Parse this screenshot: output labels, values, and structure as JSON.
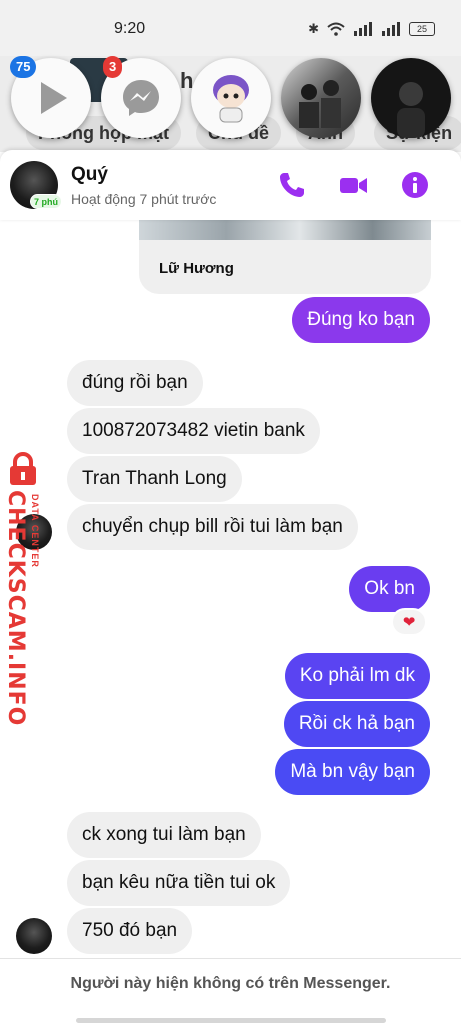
{
  "status_bar": {
    "time": "9:20",
    "battery": "25",
    "icons": [
      "bluetooth-icon",
      "wifi-icon",
      "signal-icon",
      "signal-icon",
      "battery-icon"
    ]
  },
  "background": {
    "tabs": [
      "Phòng họp mặt",
      "Chủ đề",
      "Ảnh",
      "Sự kiện"
    ],
    "partial_title": "h"
  },
  "chat_heads": {
    "badges": [
      "75",
      "3"
    ],
    "icons": [
      "play-icon",
      "messenger-icon",
      "sticker-character-icon",
      "group-photo-icon",
      "profile-photo-icon"
    ]
  },
  "header": {
    "name": "Quý",
    "status": "Hoạt động 7 phút trước",
    "avatar_badge": "7 phú",
    "accent": "#9b2ff0"
  },
  "shared_card": {
    "title": "Lữ Hương"
  },
  "messages": [
    {
      "side": "out",
      "text": "Đúng ko bạn",
      "color": "#8b39ec"
    },
    {
      "side": "in",
      "text": "đúng rồi bạn"
    },
    {
      "side": "in",
      "text": "100872073482 vietin bank"
    },
    {
      "side": "in",
      "text": "Tran Thanh Long"
    },
    {
      "side": "in",
      "text": "chuyển chụp bill rồi tui làm bạn"
    },
    {
      "side": "out",
      "text": "Ok bn",
      "color": "#6a3df0"
    },
    {
      "side": "out",
      "text": "Ko phải lm dk",
      "color": "#5a44f2"
    },
    {
      "side": "out",
      "text": "Rồi ck hả bạn",
      "color": "#4f48f3"
    },
    {
      "side": "out",
      "text": "Mà bn vậy bạn",
      "color": "#4a4bf4"
    },
    {
      "side": "in",
      "text": "ck xong tui làm bạn"
    },
    {
      "side": "in",
      "text": "bạn kêu nữa tiền tui ok"
    },
    {
      "side": "in",
      "text": "750 đó bạn"
    }
  ],
  "reaction": "❤",
  "watermark": {
    "main": "CHECKSCAM.INFO",
    "sub": "DATA CENTER"
  },
  "footer": {
    "text": "Người này hiện không có trên Messenger."
  }
}
